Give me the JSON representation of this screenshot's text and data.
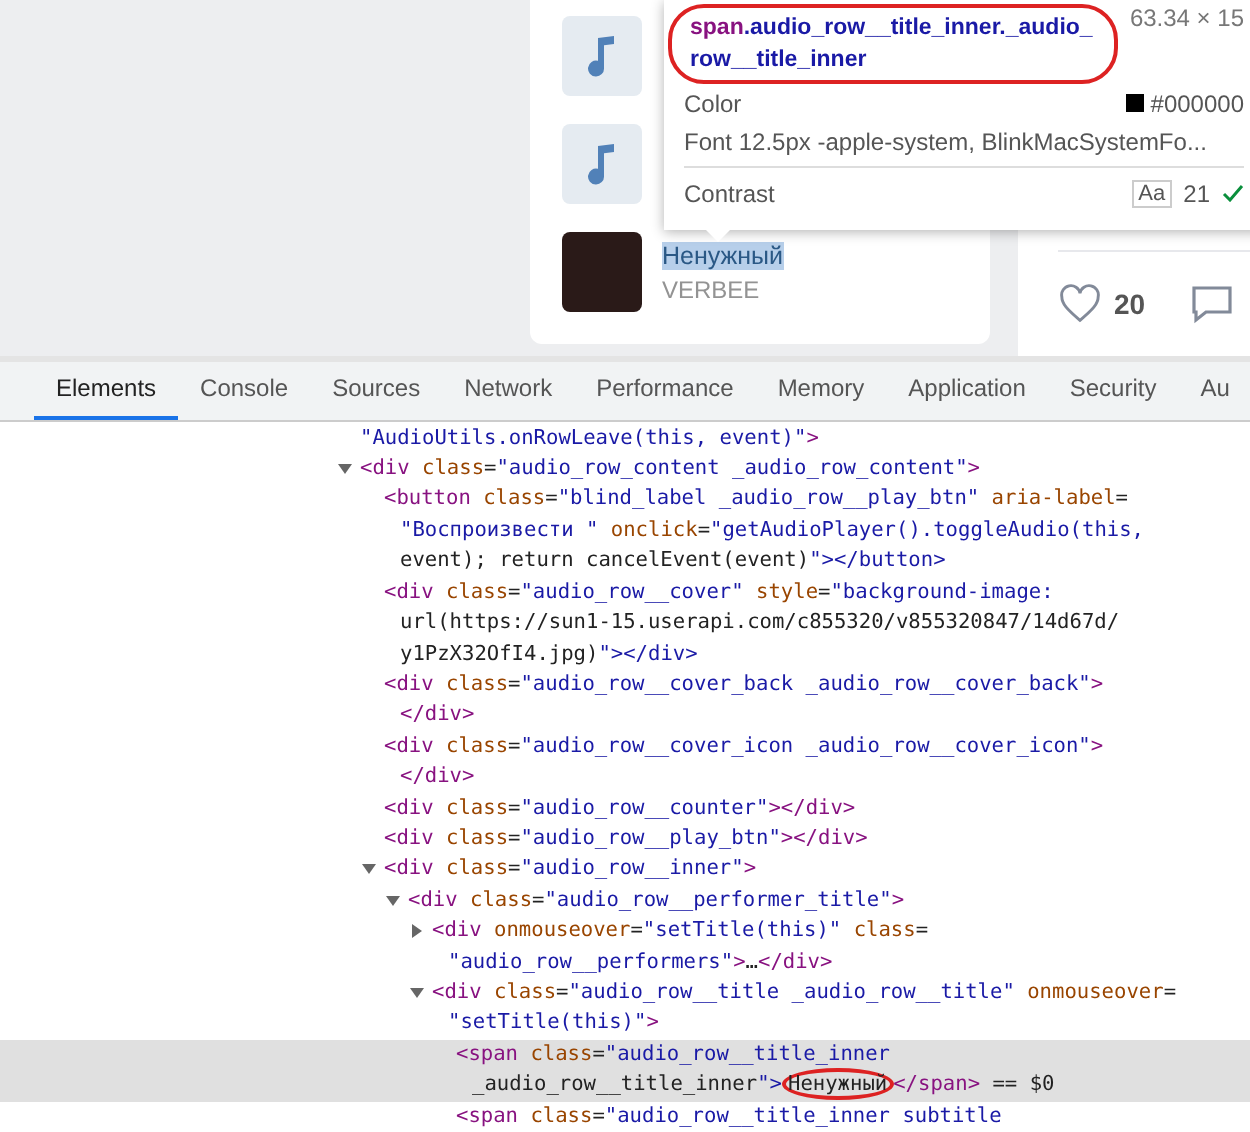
{
  "audio_list": {
    "rows": [
      {
        "kind": "placeholder"
      },
      {
        "kind": "placeholder"
      },
      {
        "kind": "cover",
        "title": "Ненужный",
        "title_selected": true,
        "artist": "VERBEE"
      }
    ]
  },
  "post_actions": {
    "likes": "20"
  },
  "inspect_tooltip": {
    "element": "span",
    "classes": ".audio_row__title_inner._audio_row__title_inner",
    "size": "63.34 × 15",
    "color_label": "Color",
    "color_value": "#000000",
    "color": "#000000",
    "font_label": "Font",
    "font_value": "12.5px -apple-system, BlinkMacSystemFo...",
    "contrast_label": "Contrast",
    "contrast_sample": "Aa",
    "contrast_value": "21",
    "contrast_ok": true
  },
  "devtools_tabs": [
    {
      "label": "Elements",
      "selected": true
    },
    {
      "label": "Console",
      "selected": false
    },
    {
      "label": "Sources",
      "selected": false
    },
    {
      "label": "Network",
      "selected": false
    },
    {
      "label": "Performance",
      "selected": false
    },
    {
      "label": "Memory",
      "selected": false
    },
    {
      "label": "Application",
      "selected": false
    },
    {
      "label": "Security",
      "selected": false
    },
    {
      "label": "Au",
      "selected": false
    }
  ],
  "dom_tree": [
    {
      "lines": [
        "\"AudioUtils.onRowLeave(this, event)\">"
      ]
    },
    {
      "lines": [
        "<div class=\"audio_row_content _audio_row_content\">"
      ],
      "expanded": true,
      "children": [
        {
          "lines": [
            "<button class=\"blind_label _audio_row__play_btn\" aria-label=",
            "\"Воспроизвести \" onclick=\"getAudioPlayer().toggleAudio(this,",
            "event); return cancelEvent(event)\"></button>"
          ]
        },
        {
          "lines": [
            "<div class=\"audio_row__cover\" style=\"background-image:",
            "url(https://sun1-15.userapi.com/c855320/v855320847/14d67d/",
            "y1PzX32OfI4.jpg)\"></div>"
          ]
        },
        {
          "lines": [
            "<div class=\"audio_row__cover_back _audio_row__cover_back\">",
            "</div>"
          ]
        },
        {
          "lines": [
            "<div class=\"audio_row__cover_icon _audio_row__cover_icon\">",
            "</div>"
          ]
        },
        {
          "lines": [
            "<div class=\"audio_row__counter\"></div>"
          ]
        },
        {
          "lines": [
            "<div class=\"audio_row__play_btn\"></div>"
          ]
        },
        {
          "lines": [
            "<div class=\"audio_row__inner\">"
          ],
          "expanded": true,
          "children": [
            {
              "lines": [
                "<div class=\"audio_row__performer_title\">"
              ],
              "expanded": true,
              "children": [
                {
                  "lines": [
                    "<div onmouseover=\"setTitle(this)\" class=",
                    "\"audio_row__performers\">…</div>"
                  ],
                  "expanded": false
                },
                {
                  "lines": [
                    "<div class=\"audio_row__title _audio_row__title\" onmouseover=",
                    "\"setTitle(this)\">"
                  ],
                  "expanded": true,
                  "children": [
                    {
                      "lines": [
                        "<span class=\"audio_row__title_inner",
                        {
                          "before": "_audio_row__title_inner\">",
                          "marked": "Ненужный",
                          "after": "</span> == $0"
                        }
                      ],
                      "selected": true
                    },
                    {
                      "lines": [
                        "<span class=\"audio_row__title_inner subtitle"
                      ],
                      "selected": false
                    }
                  ]
                }
              ]
            }
          ]
        }
      ]
    }
  ]
}
